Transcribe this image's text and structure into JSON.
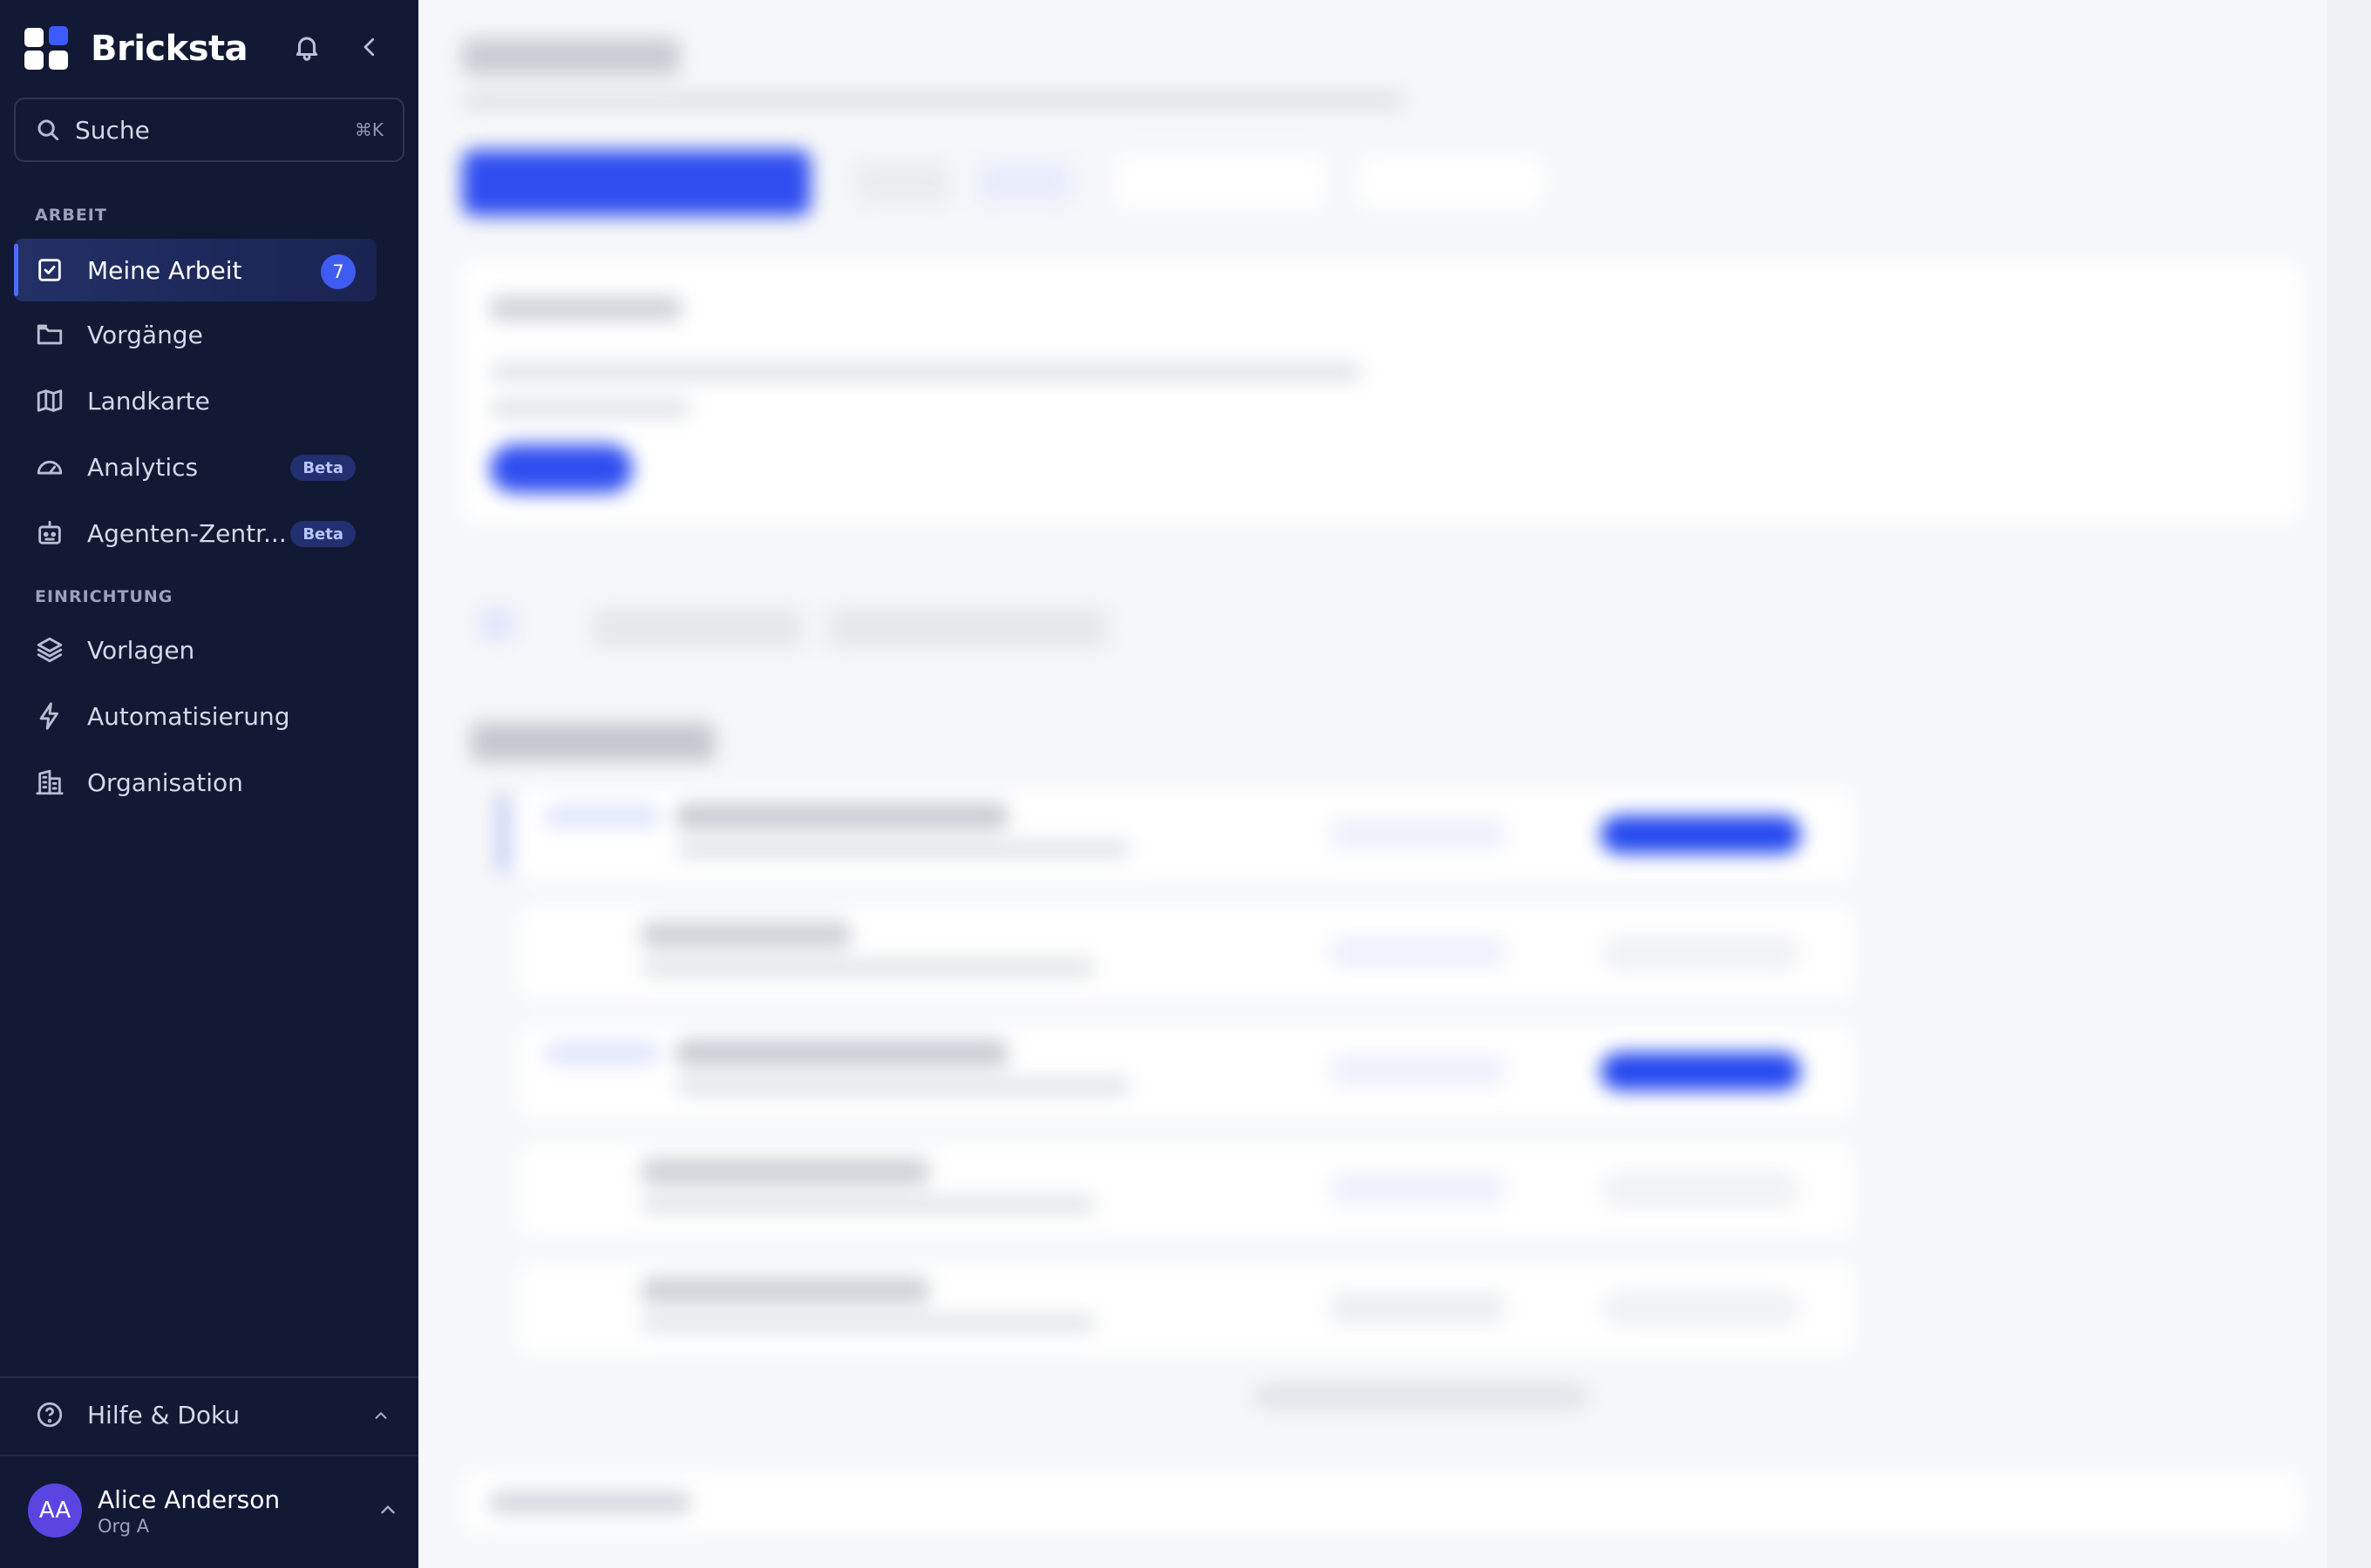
{
  "app": {
    "name": "Bricksta"
  },
  "search": {
    "label": "Suche",
    "shortcut": "⌘K"
  },
  "nav": {
    "section_work": "ARBEIT",
    "section_setup": "EINRICHTUNG",
    "items": [
      {
        "label": "Meine Arbeit",
        "icon": "checkbox-icon",
        "badge": "7",
        "active": true
      },
      {
        "label": "Vorgänge",
        "icon": "folder-icon"
      },
      {
        "label": "Landkarte",
        "icon": "map-icon"
      },
      {
        "label": "Analytics",
        "icon": "gauge-icon",
        "tag": "Beta"
      },
      {
        "label": "Agenten-Zentr...",
        "icon": "robot-icon",
        "tag": "Beta"
      },
      {
        "label": "Vorlagen",
        "icon": "layers-icon"
      },
      {
        "label": "Automatisierung",
        "icon": "lightning-icon"
      },
      {
        "label": "Organisation",
        "icon": "building-icon"
      }
    ]
  },
  "help": {
    "label": "Hilfe & Doku"
  },
  "user": {
    "initials": "AA",
    "name": "Alice Anderson",
    "org": "Org A"
  },
  "colors": {
    "sidebar_bg": "#121935",
    "accent": "#3f5cf2",
    "main_bg": "#f6f7f9"
  }
}
